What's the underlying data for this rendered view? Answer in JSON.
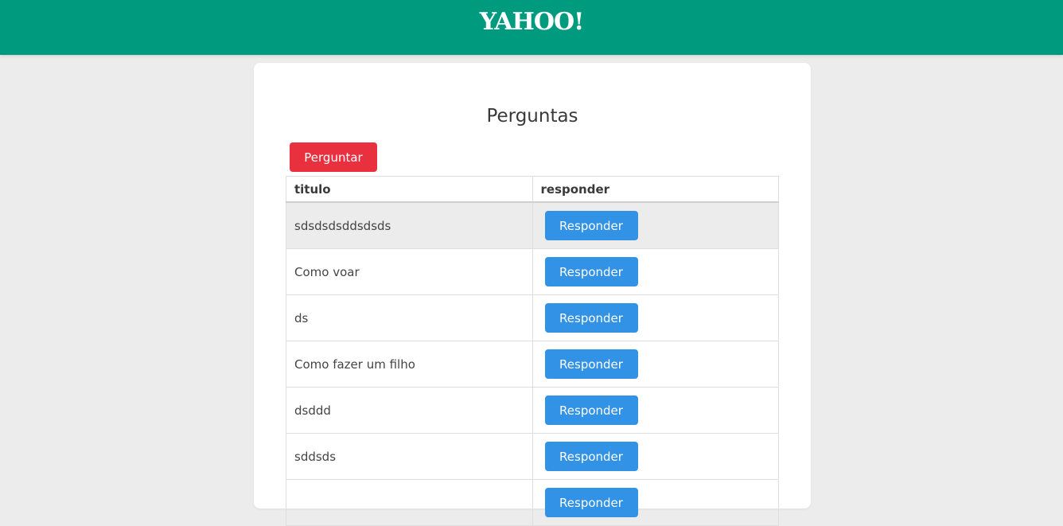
{
  "header": {
    "logo_text": "YAHOO!",
    "bg_color": "#009a7e"
  },
  "main": {
    "title": "Perguntas",
    "ask_button_label": "Perguntar",
    "ask_button_color": "#e8303f",
    "reply_button_color": "#3192e6",
    "columns": [
      "titulo",
      "responder"
    ],
    "rows": [
      {
        "titulo": "sdsdsdsddsdsds",
        "responder": "Responder",
        "highlighted": true
      },
      {
        "titulo": "Como voar",
        "responder": "Responder"
      },
      {
        "titulo": "ds",
        "responder": "Responder"
      },
      {
        "titulo": "Como fazer um filho",
        "responder": "Responder"
      },
      {
        "titulo": "dsddd",
        "responder": "Responder"
      },
      {
        "titulo": "sddsds",
        "responder": "Responder"
      },
      {
        "titulo": "",
        "responder": "Responder"
      }
    ]
  }
}
